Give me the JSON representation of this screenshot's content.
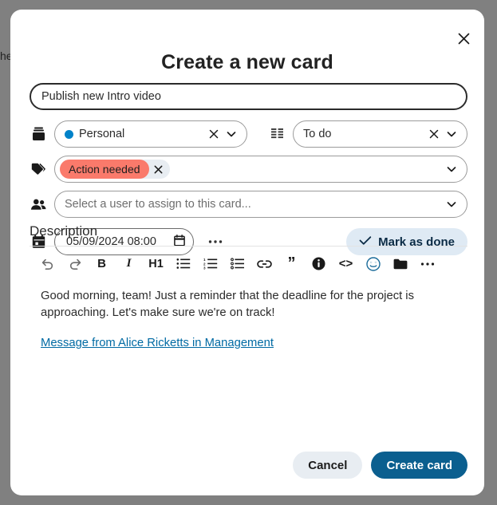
{
  "background": {
    "partial_text": "he",
    "overlay_color": "#808080"
  },
  "modal": {
    "title": "Create a new card",
    "close_icon": "close-icon"
  },
  "form": {
    "title_field": {
      "value": "Publish new Intro video",
      "placeholder": "Card title"
    },
    "board_field": {
      "icon": "board-stack-icon",
      "value": "Personal",
      "dot_color": "#0082c9",
      "clear_icon": "close-icon",
      "caret_icon": "chevron-down-icon"
    },
    "status_field": {
      "icon": "columns-grid-icon",
      "value": "To do",
      "clear_icon": "close-icon",
      "caret_icon": "chevron-down-icon"
    },
    "labels_field": {
      "icon": "tag-icon",
      "chips": [
        {
          "label": "Action needed",
          "color": "#fa7a6b",
          "remove_icon": "close-icon"
        }
      ],
      "caret_icon": "chevron-down-icon"
    },
    "assignee_field": {
      "icon": "users-icon",
      "placeholder": "Select a user to assign to this card...",
      "value": "",
      "caret_icon": "chevron-down-icon"
    },
    "due_date_field": {
      "icon": "calendar-icon",
      "value": "05/09/2024 08:00",
      "picker_icon": "calendar-icon",
      "more_icon": "ellipsis-icon"
    },
    "mark_done_button": {
      "label": "Mark as done",
      "icon": "check-icon",
      "background": "#dfeaf4",
      "text_color": "#0b2b45"
    }
  },
  "description": {
    "heading": "Description",
    "toolbar": [
      {
        "name": "undo-icon",
        "label": ""
      },
      {
        "name": "redo-icon",
        "label": ""
      },
      {
        "name": "bold-icon",
        "label": "B"
      },
      {
        "name": "italic-icon",
        "label": "I"
      },
      {
        "name": "heading1-icon",
        "label": "H1"
      },
      {
        "name": "bullet-list-icon",
        "label": ""
      },
      {
        "name": "ordered-list-icon",
        "label": ""
      },
      {
        "name": "task-list-icon",
        "label": ""
      },
      {
        "name": "link-icon",
        "label": ""
      },
      {
        "name": "blockquote-icon",
        "label": "”"
      },
      {
        "name": "info-icon",
        "label": ""
      },
      {
        "name": "code-block-icon",
        "label": "<>"
      },
      {
        "name": "emoji-icon",
        "label": ""
      },
      {
        "name": "attachment-folder-icon",
        "label": ""
      },
      {
        "name": "more-options-icon",
        "label": ""
      }
    ],
    "paragraph": "Good morning, team! Just a reminder that the deadline for the project is approaching. Let's make sure we're on track!",
    "link_text": "Message from Alice Ricketts in Management",
    "link_color": "#006aa3"
  },
  "footer": {
    "cancel_label": "Cancel",
    "create_label": "Create card",
    "create_color": "#0b5f8f"
  }
}
